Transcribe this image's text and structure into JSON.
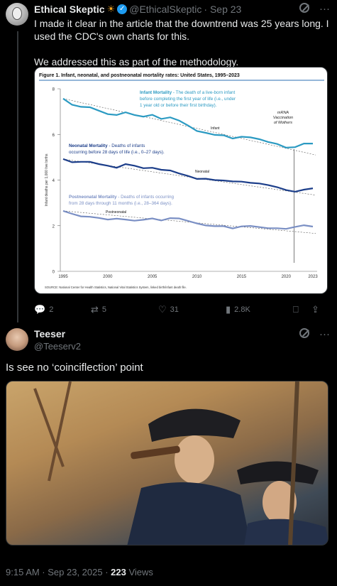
{
  "tweet1": {
    "name": "Ethical Skeptic",
    "handle": "@EthicalSkeptic",
    "date": "· Sep 23",
    "text": "I made it clear in the article that the downtrend was 25 years long. I used the CDC's own charts for this.\n\nWe addressed this as part of the methodology.",
    "stats": {
      "replies": "2",
      "reposts": "5",
      "likes": "31",
      "views": "2.8K"
    }
  },
  "chart_data": {
    "type": "line",
    "title": "Figure 1. Infant, neonatal, and postneonatal mortality rates: United States, 1995–2023",
    "ylabel": "Infant deaths per 1,000 live births",
    "xlabel": "",
    "ylim": [
      0,
      8
    ],
    "yticks": [
      "0",
      "2",
      "4",
      "6",
      "8"
    ],
    "xticks": [
      "1995",
      "2000",
      "2005",
      "2010",
      "2015",
      "2020",
      "2023"
    ],
    "x": [
      1995,
      1996,
      1997,
      1998,
      1999,
      2000,
      2001,
      2002,
      2003,
      2004,
      2005,
      2006,
      2007,
      2008,
      2009,
      2010,
      2011,
      2012,
      2013,
      2014,
      2015,
      2016,
      2017,
      2018,
      2019,
      2020,
      2021,
      2022,
      2023
    ],
    "series": [
      {
        "name": "Infant",
        "color": "#2b9ac2",
        "values": [
          7.57,
          7.3,
          7.21,
          7.19,
          7.04,
          6.89,
          6.85,
          6.97,
          6.85,
          6.78,
          6.86,
          6.68,
          6.75,
          6.61,
          6.39,
          6.15,
          6.07,
          5.98,
          5.96,
          5.82,
          5.9,
          5.87,
          5.79,
          5.67,
          5.58,
          5.42,
          5.44,
          5.6,
          5.6
        ]
      },
      {
        "name": "Neonatal",
        "color": "#1c3e8a",
        "values": [
          4.92,
          4.78,
          4.8,
          4.8,
          4.7,
          4.63,
          4.54,
          4.7,
          4.63,
          4.52,
          4.54,
          4.45,
          4.42,
          4.29,
          4.18,
          4.05,
          4.06,
          4.0,
          3.98,
          3.94,
          3.93,
          3.88,
          3.85,
          3.78,
          3.69,
          3.56,
          3.49,
          3.58,
          3.64
        ]
      },
      {
        "name": "Postneonatal",
        "color": "#7a8fc4",
        "values": [
          2.65,
          2.52,
          2.41,
          2.39,
          2.34,
          2.27,
          2.31,
          2.27,
          2.22,
          2.26,
          2.32,
          2.23,
          2.33,
          2.32,
          2.21,
          2.1,
          2.01,
          1.98,
          1.98,
          1.88,
          1.97,
          1.99,
          1.94,
          1.89,
          1.89,
          1.86,
          1.95,
          2.02,
          1.96
        ]
      }
    ],
    "annotations": {
      "infant": "Infant Mortality",
      "infant_desc": " - The death of a live-born infant before completing the first year of life (i.e., under 1 year old or before their first birthday).",
      "neonatal": "Neonatal Mortality",
      "neonatal_desc": " - Deaths of infants occurring before 28 days of life (i.e., 0–27 days).",
      "postneonatal": "Postneonatal Mortality",
      "postneonatal_desc": " - Deaths of infants occurring from 28 days through 11 months (i.e., 28–364 days).",
      "mrna": "mRNA Vaccination of Mothers",
      "infant_label": "Infant",
      "neonatal_label": "Neonatal",
      "postneonatal_label": "Postneonatal",
      "source": "SOURCE: National Center for Health Statistics, National Vital Statistics System, linked birth/infant death file."
    }
  },
  "tweet2": {
    "name": "Teeser",
    "handle": "@Teeserv2",
    "text": "Is see no ‘coinciflection’ point",
    "timestamp": "9:15 AM · Sep 23, 2025 · ",
    "views_count": "223",
    "views_label": " Views"
  }
}
